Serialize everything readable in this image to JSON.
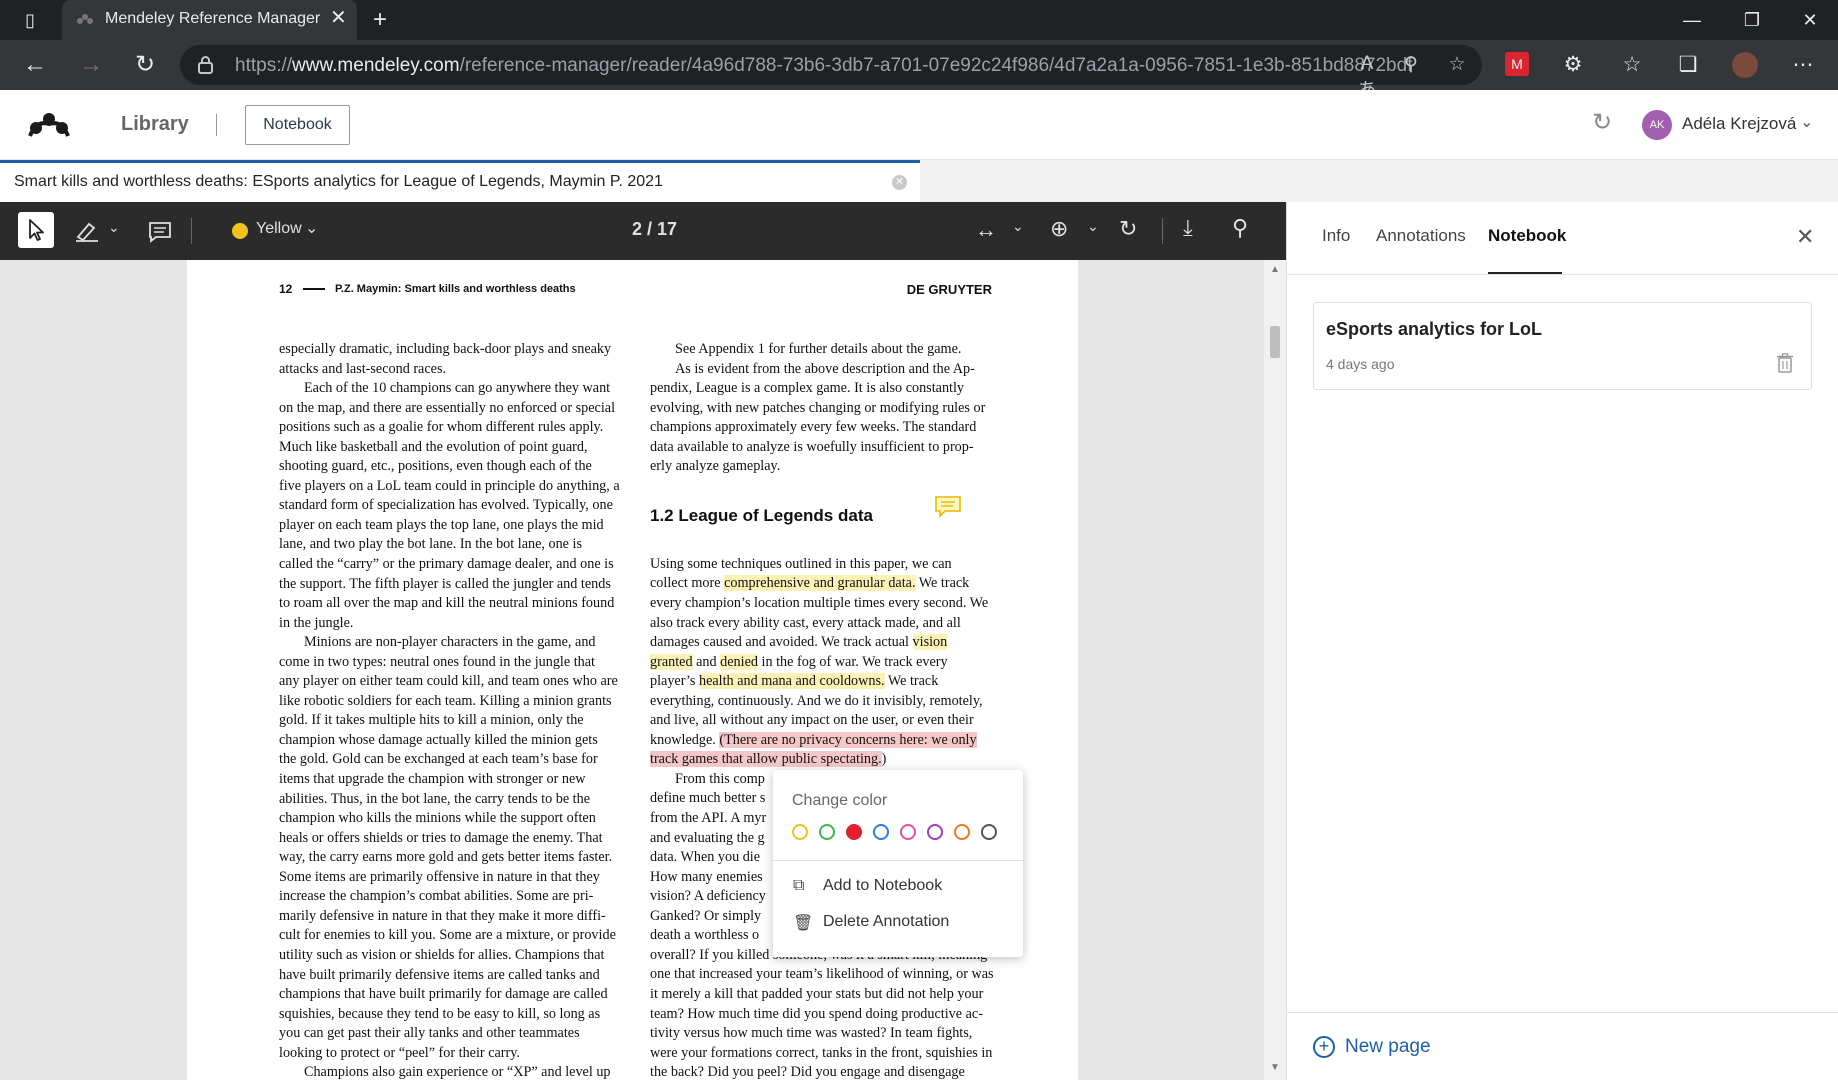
{
  "browser": {
    "tab_title": "Mendeley Reference Manager",
    "url_prefix": "https://",
    "url_host": "www.mendeley.com",
    "url_path": "/reference-manager/reader/4a96d788-73b6-3db7-a701-07e92c24f986/4d7a2a1a-0956-7851-1e3b-851bd8872bdf"
  },
  "header": {
    "library_label": "Library",
    "notebook_button": "Notebook",
    "user_initials": "AK",
    "user_name": "Adéla Krejzová"
  },
  "doc_tab": {
    "title": "Smart kills and worthless deaths: ESports analytics for League of Legends, Maymin P. 2021"
  },
  "toolbar": {
    "color_label": "Yellow",
    "page_indicator": "2 / 17"
  },
  "page": {
    "page_number": "12",
    "running_title": "P.Z. Maymin: Smart kills and worthless deaths",
    "publisher": "DE GRUYTER",
    "section_heading": "1.2  League of Legends data"
  },
  "context_menu": {
    "header": "Change color",
    "add_to_notebook": "Add to Notebook",
    "delete_annotation": "Delete Annotation",
    "swatches": [
      "#f2c21b",
      "#3fb64a",
      "#e0202c",
      "#2e7de0",
      "#e84fa6",
      "#9b3fc4",
      "#ef7a1a",
      "#555555"
    ]
  },
  "right_panel": {
    "tabs": [
      "Info",
      "Annotations",
      "Notebook"
    ],
    "active_tab": "Notebook",
    "card_title": "eSports analytics for LoL",
    "card_date": "4 days ago",
    "new_page_label": "New page"
  },
  "colors": {
    "accent_blue": "#1f5fa8",
    "highlight_yellow": "#fdf2b5",
    "highlight_red": "#f6c7c9",
    "toolbar_bg": "#2b2b2b"
  }
}
